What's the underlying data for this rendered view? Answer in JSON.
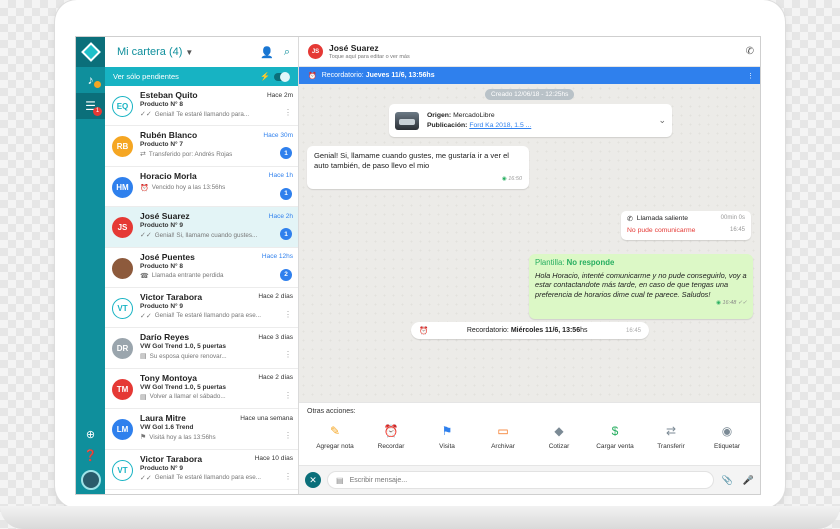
{
  "list": {
    "title": "Mi cartera (4)",
    "filter_label": "Ver sólo pendientes",
    "items": [
      {
        "name": "Esteban Quito",
        "sub": "Producto N° 8",
        "preview": "Genial! Te estaré llamando para...",
        "time": "Hace 2m",
        "initials": "EQ",
        "avatar_bg": "#ffffff",
        "avatar_fg": "#17b3c3",
        "avatar_border": "#17b3c3",
        "preview_icon": "✓✓",
        "badge": "",
        "accent_time": false
      },
      {
        "name": "Rubén Blanco",
        "sub": "Producto N° 7",
        "preview": "Transferido por: Andrés Rojas",
        "time": "Hace 30m",
        "initials": "RB",
        "avatar_bg": "#f5a623",
        "avatar_fg": "#ffffff",
        "avatar_border": "#f5a623",
        "preview_icon": "⇄",
        "badge": "1",
        "accent_time": true
      },
      {
        "name": "Horacio Morla",
        "sub": "",
        "preview": "Vencido hoy a las 13:56hs",
        "time": "Hace 1h",
        "initials": "HM",
        "avatar_bg": "#2f80ed",
        "avatar_fg": "#ffffff",
        "avatar_border": "#2f80ed",
        "preview_icon": "⏰",
        "badge": "1",
        "accent_time": true
      },
      {
        "name": "José Suarez",
        "sub": "Producto N° 9",
        "preview": "Genial! Si, llamame cuando gustes...",
        "time": "Hace 2h",
        "initials": "JS",
        "avatar_bg": "#e53935",
        "avatar_fg": "#ffffff",
        "avatar_border": "#e53935",
        "preview_icon": "✓✓",
        "badge": "1",
        "accent_time": true
      },
      {
        "name": "José Puentes",
        "sub": "Producto N° 8",
        "preview": "Llamada entrante perdida",
        "time": "Hace 12hs",
        "initials": "",
        "avatar_bg": "#8d5a3c",
        "avatar_fg": "#ffffff",
        "avatar_border": "#8d5a3c",
        "preview_icon": "☎",
        "badge": "2",
        "accent_time": true
      },
      {
        "name": "Victor Tarabora",
        "sub": "Producto N° 9",
        "preview": "Genial! Te estaré llamando para ese...",
        "time": "Hace 2 días",
        "initials": "VT",
        "avatar_bg": "#ffffff",
        "avatar_fg": "#17b3c3",
        "avatar_border": "#17b3c3",
        "preview_icon": "✓✓",
        "badge": "",
        "accent_time": false
      },
      {
        "name": "Darío Reyes",
        "sub": "VW Gol Trend 1.0, 5 puertas",
        "preview": "Su esposa quiere renovar...",
        "time": "Hace 3 días",
        "initials": "DR",
        "avatar_bg": "#9aa5ad",
        "avatar_fg": "#ffffff",
        "avatar_border": "#9aa5ad",
        "preview_icon": "▤",
        "badge": "",
        "accent_time": false
      },
      {
        "name": "Tony Montoya",
        "sub": "VW Gol Trend 1.0, 5 puertas",
        "preview": "Volver a llamar el sábado...",
        "time": "Hace 2 días",
        "initials": "TM",
        "avatar_bg": "#e53935",
        "avatar_fg": "#ffffff",
        "avatar_border": "#e53935",
        "preview_icon": "▤",
        "badge": "",
        "accent_time": false
      },
      {
        "name": "Laura Mitre",
        "sub": "VW Gol 1.6 Trend",
        "preview": "Visitá hoy a las 13:56hs",
        "time": "Hace una semana",
        "initials": "LM",
        "avatar_bg": "#2f80ed",
        "avatar_fg": "#ffffff",
        "avatar_border": "#2f80ed",
        "preview_icon": "⚑",
        "badge": "",
        "accent_time": false
      },
      {
        "name": "Victor Tarabora",
        "sub": "Producto N° 9",
        "preview": "Genial! Te estaré llamando para ese...",
        "time": "Hace 10 días",
        "initials": "VT",
        "avatar_bg": "#ffffff",
        "avatar_fg": "#17b3c3",
        "avatar_border": "#17b3c3",
        "preview_icon": "✓✓",
        "badge": "",
        "accent_time": false
      }
    ]
  },
  "chat": {
    "initials": "JS",
    "name": "José Suarez",
    "subtitle": "Toque aquí para editar o ver más",
    "reminder_bar_prefix": "Recordatorio:",
    "reminder_bar_value": "Jueves 11/6, 13:56hs",
    "date_chip": "Creado 12/06/18 - 12:25hs",
    "origin_label": "Origen:",
    "origin_value": "MercadoLibre",
    "publication_label": "Publicación:",
    "publication_value": "Ford Ka 2018, 1.5 ...",
    "incoming_text": "Genial! Si, llamame cuando gustes, me gustaría ir a ver el auto también, de paso llevo el mio",
    "incoming_time": "16:50",
    "call_title": "Llamada saliente",
    "call_duration": "00min 0s",
    "call_status": "No pude comunicarme",
    "call_time": "16:45",
    "template_label": "Plantilla:",
    "template_name": "No responde",
    "template_text": "Hola Horacio, intenté comunicarme y no pude conseguirlo, voy a estar contactandote más tarde, en caso de que tengas una preferencia de horarios dime cual te parece. Saludos!",
    "template_time": "16:48",
    "reminder_pill_prefix": "Recordatorio:",
    "reminder_pill_value": "Miércoles 11/6, 13:56",
    "reminder_pill_suffix": "hs",
    "reminder_pill_time": "16:45"
  },
  "actions": {
    "title": "Otras acciones:",
    "items": [
      {
        "label": "Agregar nota",
        "icon": "note-icon",
        "glyph": "✎",
        "color": "#f5a623"
      },
      {
        "label": "Recordar",
        "icon": "alarm-icon",
        "glyph": "⏰",
        "color": "#2f80ed"
      },
      {
        "label": "Visita",
        "icon": "walk-icon",
        "glyph": "⚑",
        "color": "#2f80ed"
      },
      {
        "label": "Archivar",
        "icon": "archive-icon",
        "glyph": "▭",
        "color": "#f5731c"
      },
      {
        "label": "Cotizar",
        "icon": "tag-icon",
        "glyph": "◆",
        "color": "#7b8a95"
      },
      {
        "label": "Cargar venta",
        "icon": "sale-tag-icon",
        "glyph": "$",
        "color": "#27ae60"
      },
      {
        "label": "Transferir",
        "icon": "transfer-icon",
        "glyph": "⇄",
        "color": "#7b8a95"
      },
      {
        "label": "Etiquetar",
        "icon": "label-icon",
        "glyph": "◉",
        "color": "#7b8a95"
      }
    ]
  },
  "input": {
    "placeholder": "Escribir mensaje..."
  }
}
